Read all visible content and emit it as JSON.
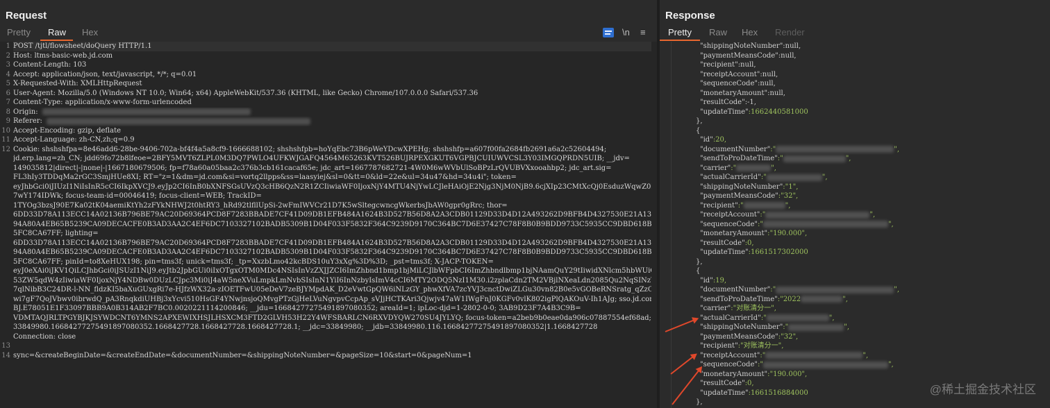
{
  "request": {
    "title": "Request",
    "tabs": [
      "Pretty",
      "Raw",
      "Hex"
    ],
    "active_tab": "Raw",
    "newline_toggle": "\\n",
    "lines": [
      "POST /tjtl/flowsheet/doQuery HTTP/1.1",
      "Host: ltms-basic-web.jd.com",
      "Content-Length: 103",
      "Accept: application/json, text/javascript, */*; q=0.01",
      "X-Requested-With: XMLHttpRequest",
      "User-Agent: Mozilla/5.0 (Windows NT 10.0; Win64; x64) AppleWebKit/537.36 (KHTML, like Gecko) Chrome/107.0.0.0 Safari/537.36",
      "Content-Type: application/x-www-form-urlencoded",
      "Origin:",
      "Referer:",
      "Accept-Encoding: gzip, deflate",
      "Accept-Language: zh-CN,zh;q=0.9",
      "Cookie: shshshfpa=8e46add6-28be-9406-702a-bf4f4a5a8cf9-1666688102; shshshfpb=hoYqEbc73B6pWeYDcwXPEHg; shshshfp=a607f00fa2684fb2691a6a2c52604494;",
      "jd.erp.lang=zh_CN; jdd69fo72b8lfeoe=2BFY5MVT6ZLPL0M3DQ7PWLO4UFKWJGAFQ4564M65263KVT526BUJRPEXGKUT6VGPBJCUIUWVCSL3Y03IMGQPRDN5UIB; __jdv=",
      "149035812|direct|-|none|-|1667180679506; fp=f78a60a05baa2c376b3cb161cacaf65e; jdc_art=1667787682721-4W0M6wWVbUlSoBPzLrQVUBVXxooahbp2; jdc_art.sig=",
      "FL3hIy3TDDqMa2rGC3SmjHUe8XI; RT=\"z=1&dm=jd.com&si=vortq2llpps&ss=laasyiej&sl=0&tt=0&ld=22e&ul=34u47&hd=34u4i\"; token=",
      "eyJhbGci0iJIUzI1NiIsInR5cCI6IkpXVCJ9.eyJp2CI6InB0bXNFSGsUVzQ3cHB6QzN2R1ZCIiwiaWF0IjoxNjY4MTU4NjYwLCJleHAiOjE2Njg3NjM0NjB9.6cjXIp23CMtXcQj0EsduzWqwZ0KfCC7z6",
      "7wY174IDWk; focus-team-id=00046419; focus-client=WEB; TrackID=",
      "1TYOg3bzsJ90E7Ka02tK04aemiKtYh2zFYkNHWJ2t0htRY3_hRd92tlfllUpSi-2wFmIWVCr21D7K5wSltegcwncgWkerbsJbAW0gpr0gRrc; thor=",
      "6DD33D78A113ECC14A02136B796BE79AC20D69364PCD8F7283BBADE7CF41D09DB1EFB484A1624B3D527B56D8A2A3CDB01129D33D4D12A493262D9BFB4D4327530E21A1314814C0392B1225A134F",
      "94A80A4EB65B5239CA09DECACFE0B3AD3AA2C4EF6DC7103327102BADB5309B1D04F033F5832F364C9239D9170C364BC7D6E37427C78F8B0B9BDD9733C5935CC9DBD618B8A3C90A207349220B193",
      "5FC8CA67FF; lighting=",
      "6DD33D78A113ECC14A02136B796BE79AC20D69364PCD8F7283BBADE7CF41D09DB1EFB484A1624B3D527B56D8A2A3CDB01129D33D4D12A493262D9BFB4D4327530E21A1314814C0392B1225A134F",
      "94A80A4EB65B5239CA09DECACFE0B3AD3AA2C4EF6DC7103327102BADB5309B1D04F033F5832F364C9239D9170C364BC7D6E37427C78F8B0B9BDD9733C5935CC9DBD618B8A3C90A207349220B193",
      "5FC8CA67FF; pinId=to8XeHUX198; pin=tms3f; unick=tms3f; _tp=XxzbLmo42kcBDS10uY3xXg%3D%3D; _pst=tms3f; X-JACP-TOKEN=",
      "eyJ0eXAi0iJKV1QiLCJhbGci0iJSUzI1NiJ9.eyJtb2JpbGUi0iIxOTgxOTM0MDc4NSIsInVzZXJJZCI6ImZhbnd1bmp1bjMiLCJlbWFpbCI6ImZhbndlbmp1bjNAamQuY29tIiwidXNlcm5hbWUiOiJmYW",
      "53ZW5qdW4zIiwiaWF0IjoxNjY4NDBw0DUzLCJpc3Mi0iJ4aW5neXVuLmpkLmNvbSIsInN1YiI6InNzbyIsImV4cCI6MTY2ODQ5NzI1M30.i2zplaCdn2TM2VBjlNXeaLdn2085Qu2NqSINzVQX_R_Kou4-x",
      "7qlNibB3C24DR-l-NN_fldzKI5baXuGUxgRi7e-HJfzWX32a-zIOETFwU05eDeV7zeBJYMpdAK_D2eVwtGpQW6iNLzGY_phwXfVA7zcYVJ3cnctDwiZLGu30vn82B0e5vGOBeRNSratg_qZzC-rIby5A",
      "wi7gF7QoJVbwv0ibrwdQ_pA3RnqkdiUHBj3xYcvi510HsGF4YNwjnsjoQMvgPTzGjHeLVuNgvpvCcpAp_sVJjHCTKAri3Qjwjv47aW1IWgFnJ0KGFv0vlK802igPlQAKOuV-Ih1AJg; sso.jd.com=",
      "BJ.E78051E1F33097BBB9A0B314AB2F7BC0.0020221114200846; __jdu=16684277275491897080352; areaId=1; ipLoc-djd=1-2802-0-0; 3AB9D23F7A4B3C9B=",
      "VDMTAQJRLTPGYBJKJSYWDCNT6YMNS2APXEWIXHSJLHSXCM3FTD2GLVH53H22Y4WFSBARLCN6RXVDYQW270SU4JYLYQ; focus-token=a2beb9b0eae0da906c07887554ef68ad; __jda=",
      "33849980.16684277275491897080352.1668427728.1668427728.1668427728.1; __jdc=33849980; __jdb=33849980.116.16684277275491897080352|1.1668427728",
      "Connection: close",
      "",
      "sync=&createBeginDate=&createEndDate=&documentNumber=&shippingNoteNumber=&pageSize=10&start=0&pageNum=1"
    ],
    "line_numbers": [
      "1",
      "2",
      "3",
      "4",
      "5",
      "6",
      "7",
      "8",
      "9",
      "10",
      "11",
      "12",
      "",
      "",
      "",
      "",
      "",
      "",
      "",
      "",
      "",
      "",
      "",
      "",
      "",
      "",
      "",
      "",
      "",
      "",
      "",
      "",
      "13",
      "14",
      "15"
    ]
  },
  "response": {
    "title": "Response",
    "tabs": [
      "Pretty",
      "Raw",
      "Hex",
      "Render"
    ],
    "active_tab": "Pretty",
    "lines": [
      {
        "indent": 6,
        "key": "\"shippingNoteNumber\"",
        "val": ":null,",
        "type": "n"
      },
      {
        "indent": 6,
        "key": "\"paymentMeansCode\"",
        "val": ":null,",
        "type": "n"
      },
      {
        "indent": 6,
        "key": "\"recipient\"",
        "val": ":null,",
        "type": "n"
      },
      {
        "indent": 6,
        "key": "\"receiptAccount\"",
        "val": ":null,",
        "type": "n"
      },
      {
        "indent": 6,
        "key": "\"sequenceCode\"",
        "val": ":null,",
        "type": "n"
      },
      {
        "indent": 6,
        "key": "\"monetaryAmount\"",
        "val": ":null,",
        "type": "n"
      },
      {
        "indent": 6,
        "key": "\"resultCode\"",
        "val": ":-1,",
        "type": "n"
      },
      {
        "indent": 6,
        "key": "\"updateTime\"",
        "val": ":1662440581000",
        "type": "v"
      },
      {
        "indent": 4,
        "key": "},",
        "val": "",
        "type": "p"
      },
      {
        "indent": 4,
        "key": "{",
        "val": "",
        "type": "p"
      },
      {
        "indent": 6,
        "key": "\"id\"",
        "val": ":20,",
        "type": "v"
      },
      {
        "indent": 6,
        "key": "\"documentNumber\"",
        "val": ":\"",
        "type": "b",
        "blur": 170
      },
      {
        "indent": 6,
        "key": "\"sendToProDateTime\"",
        "val": ":\"",
        "type": "b",
        "blur": 90
      },
      {
        "indent": 6,
        "key": "\"carrier\"",
        "val": ":\"",
        "type": "b",
        "blur": 50
      },
      {
        "indent": 6,
        "key": "\"actualCarrierId\"",
        "val": ":\"",
        "type": "b",
        "blur": 80
      },
      {
        "indent": 6,
        "key": "\"shippingNoteNumber\"",
        "val": ":\"1\",",
        "type": "v"
      },
      {
        "indent": 6,
        "key": "\"paymentMeansCode\"",
        "val": ":\"32\",",
        "type": "v"
      },
      {
        "indent": 6,
        "key": "\"recipient\"",
        "val": ":\"",
        "type": "b",
        "blur": 60
      },
      {
        "indent": 6,
        "key": "\"receiptAccount\"",
        "val": ":\"",
        "type": "b",
        "blur": 150
      },
      {
        "indent": 6,
        "key": "\"sequenceCode\"",
        "val": ":\"",
        "type": "b",
        "blur": 180
      },
      {
        "indent": 6,
        "key": "\"monetaryAmount\"",
        "val": ":\"190.000\",",
        "type": "v"
      },
      {
        "indent": 6,
        "key": "\"resultCode\"",
        "val": ":0,",
        "type": "v"
      },
      {
        "indent": 6,
        "key": "\"updateTime\"",
        "val": ":1661517302000",
        "type": "v"
      },
      {
        "indent": 4,
        "key": "},",
        "val": "",
        "type": "p"
      },
      {
        "indent": 4,
        "key": "{",
        "val": "",
        "type": "p"
      },
      {
        "indent": 6,
        "key": "\"id\"",
        "val": ":19,",
        "type": "v"
      },
      {
        "indent": 6,
        "key": "\"documentNumber\"",
        "val": ":\"",
        "type": "b",
        "blur": 170
      },
      {
        "indent": 6,
        "key": "\"sendToProDateTime\"",
        "val": ":\"2022",
        "type": "b",
        "blur": 60
      },
      {
        "indent": 6,
        "key": "\"carrier\"",
        "val": ":\"对账清分一\",",
        "type": "v"
      },
      {
        "indent": 6,
        "key": "\"actualCarrierId\"",
        "val": ":\"",
        "type": "b",
        "blur": 90
      },
      {
        "indent": 6,
        "key": "\"shippingNoteNumber\"",
        "val": ":\"",
        "type": "b",
        "blur": 80
      },
      {
        "indent": 6,
        "key": "\"paymentMeansCode\"",
        "val": ":\"32\",",
        "type": "v"
      },
      {
        "indent": 6,
        "key": "\"recipient\"",
        "val": ":\"对账清分一\",",
        "type": "v"
      },
      {
        "indent": 6,
        "key": "\"receiptAccount\"",
        "val": ":\"",
        "type": "b",
        "blur": 140
      },
      {
        "indent": 6,
        "key": "\"sequenceCode\"",
        "val": ":\"",
        "type": "b",
        "blur": 180
      },
      {
        "indent": 6,
        "key": "\"monetaryAmount\"",
        "val": ":\"190.000\",",
        "type": "v"
      },
      {
        "indent": 6,
        "key": "\"resultCode\"",
        "val": ":0,",
        "type": "v"
      },
      {
        "indent": 6,
        "key": "\"updateTime\"",
        "val": ":1661516884000",
        "type": "v"
      },
      {
        "indent": 4,
        "key": "},",
        "val": "",
        "type": "p"
      }
    ]
  },
  "watermark": "@稀土掘金技术社区",
  "colors": {
    "accent": "#e8672f",
    "string": "#9ec25e",
    "arrow": "#e0482b",
    "wrap_button": "#2f6fd0"
  }
}
